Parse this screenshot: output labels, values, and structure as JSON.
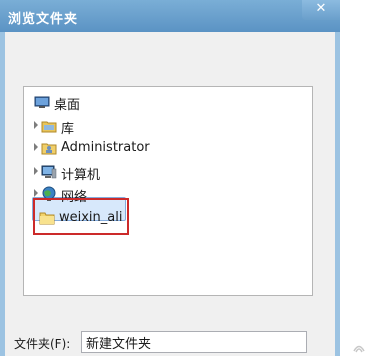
{
  "window": {
    "title": "浏览文件夹",
    "close_glyph": "✕"
  },
  "tree": {
    "items": [
      {
        "label": "桌面",
        "icon": "desktop-icon",
        "expandable": false
      },
      {
        "label": "库",
        "icon": "library-icon",
        "expandable": true
      },
      {
        "label": "Administrator",
        "icon": "user-folder-icon",
        "expandable": true
      },
      {
        "label": "计算机",
        "icon": "computer-icon",
        "expandable": true
      },
      {
        "label": "网络",
        "icon": "network-icon",
        "expandable": true
      },
      {
        "label": "weixin_ali",
        "icon": "folder-icon",
        "expandable": false,
        "selected": true
      }
    ]
  },
  "folder_field": {
    "label": "文件夹(F):",
    "value": "新建文件夹"
  },
  "colors": {
    "titlebar": "#6a9fcb",
    "highlight": "#cc2a2a",
    "selection": "#d7e8fb"
  }
}
